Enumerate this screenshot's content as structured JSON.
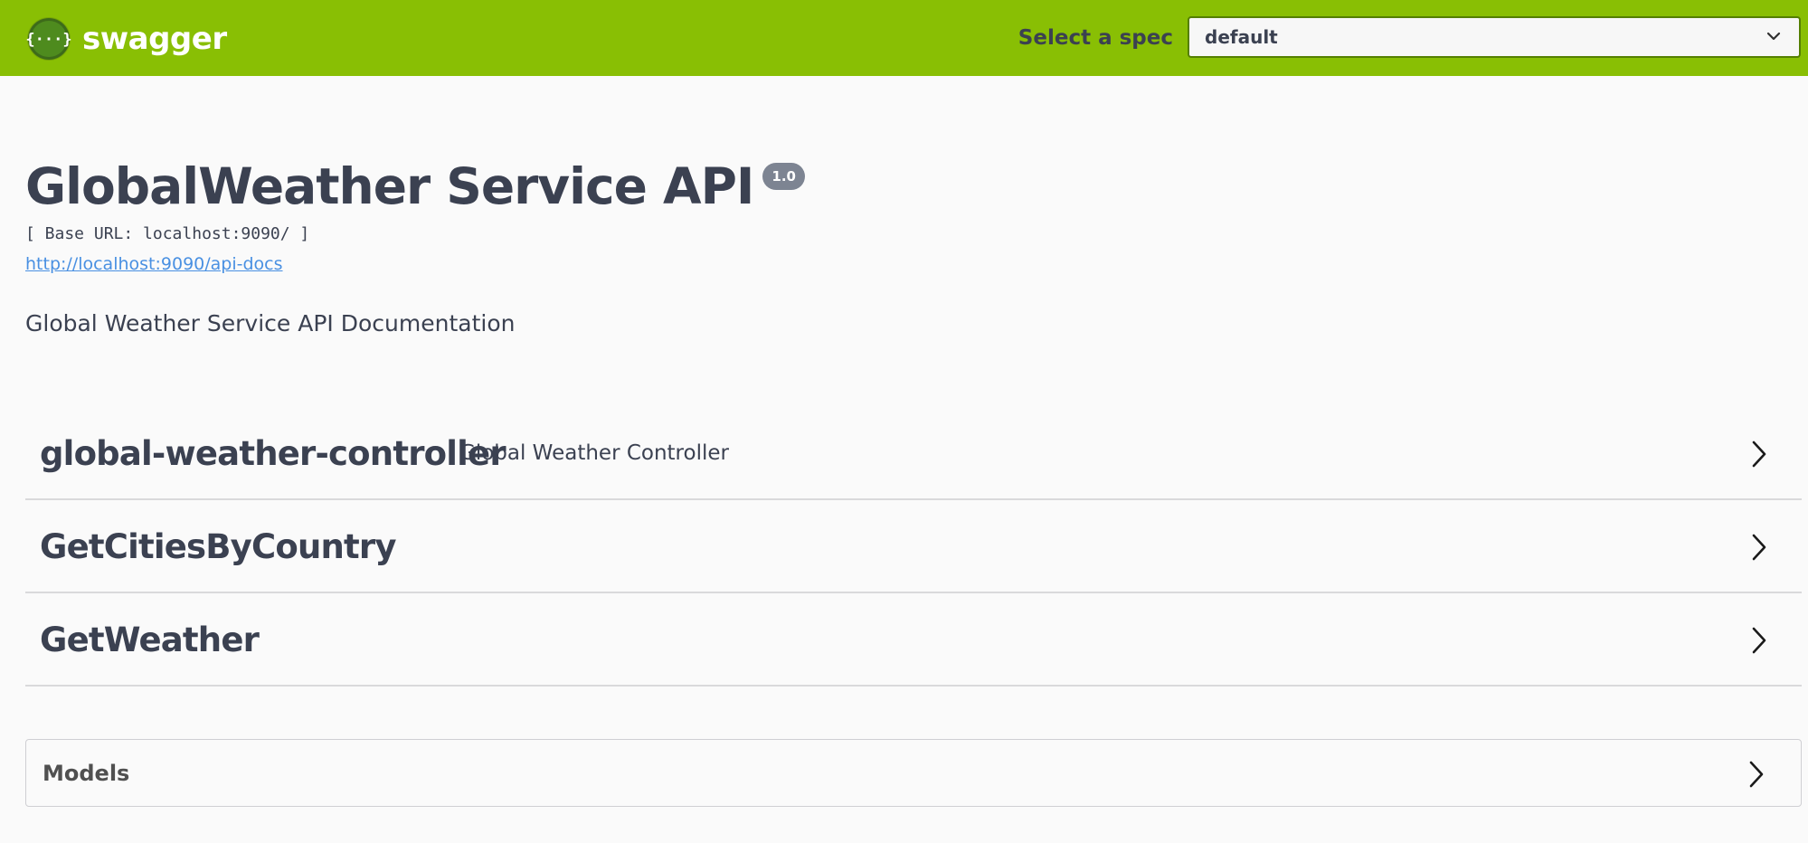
{
  "topbar": {
    "brand_name": "swagger",
    "spec_label": "Select a spec",
    "spec_selected": "default",
    "background_color": "#89bf04"
  },
  "info": {
    "title": "GlobalWeather Service API",
    "version": "1.0",
    "base_url": "[ Base URL: localhost:9090/ ]",
    "docs_link": "http://localhost:9090/api-docs",
    "description": "Global Weather Service API Documentation"
  },
  "tags": [
    {
      "name": "global-weather-controller",
      "description": "Global Weather Controller",
      "expanded": false
    },
    {
      "name": "GetCitiesByCountry",
      "description": "",
      "expanded": false
    },
    {
      "name": "GetWeather",
      "description": "",
      "expanded": false
    }
  ],
  "models": {
    "title": "Models",
    "expanded": false
  },
  "icons": {
    "logo": "swagger-logo-icon",
    "select_chevron": "chevron-down-icon",
    "tag_chevron": "chevron-right-icon"
  }
}
